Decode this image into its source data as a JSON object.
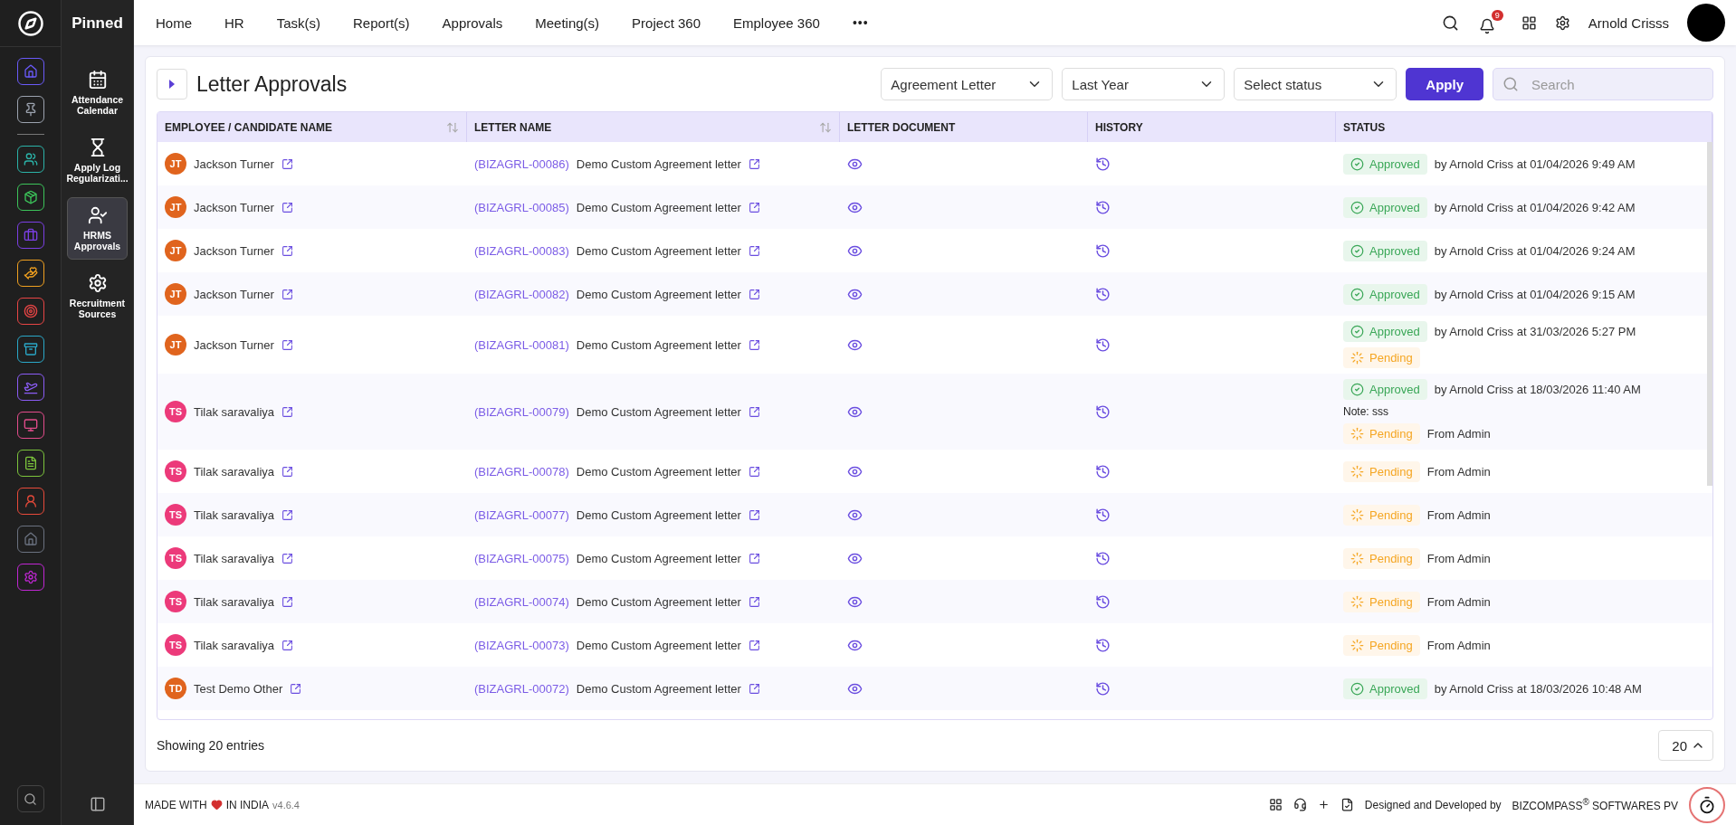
{
  "rail": {
    "items": [
      {
        "color": "#6a5af9",
        "selected": false
      },
      {
        "color": "#9ca3af",
        "selected": false
      },
      {
        "color": "#2bb3a8",
        "selected": false
      },
      {
        "color": "#3cc45a",
        "selected": false
      },
      {
        "color": "#7b3fe4",
        "selected": false
      },
      {
        "color": "#f0a020",
        "selected": false
      },
      {
        "color": "#e84545",
        "selected": false
      },
      {
        "color": "#2aa8c8",
        "selected": false
      },
      {
        "color": "#8b5cf6",
        "selected": false
      },
      {
        "color": "#e44c8c",
        "selected": false
      },
      {
        "color": "#7cc43c",
        "selected": false
      },
      {
        "color": "#e84a3a",
        "selected": false
      },
      {
        "color": "#6b7280",
        "selected": false
      },
      {
        "color": "#c026d3",
        "selected": false
      }
    ]
  },
  "pinned": {
    "title": "Pinned",
    "items": [
      {
        "label": "Attendance Calendar",
        "selected": false
      },
      {
        "label": "Apply Log Regularizati...",
        "selected": false
      },
      {
        "label": "HRMS Approvals",
        "selected": true
      },
      {
        "label": "Recruitment Sources",
        "selected": false
      }
    ]
  },
  "nav": {
    "items": [
      {
        "label": "Home"
      },
      {
        "label": "HR"
      },
      {
        "label": "Task(s)"
      },
      {
        "label": "Report(s)"
      },
      {
        "label": "Approvals"
      },
      {
        "label": "Meeting(s)"
      },
      {
        "label": "Project 360"
      },
      {
        "label": "Employee 360"
      }
    ],
    "more": "•••"
  },
  "header_user": {
    "notifications": "9",
    "name": "Arnold Crisss"
  },
  "page": {
    "title": "Letter Approvals",
    "filters": [
      {
        "value": "Agreement Letter"
      },
      {
        "value": "Last Year"
      },
      {
        "placeholder": "Select status"
      }
    ],
    "apply": "Apply",
    "search": {
      "placeholder": "Search"
    }
  },
  "table": {
    "columns": [
      {
        "label": "EMPLOYEE / CANDIDATE NAME",
        "sortable": true
      },
      {
        "label": "LETTER NAME",
        "sortable": true
      },
      {
        "label": "LETTER DOCUMENT",
        "sortable": false
      },
      {
        "label": "HISTORY",
        "sortable": false
      },
      {
        "label": "STATUS",
        "sortable": false
      }
    ],
    "rows": [
      {
        "initials": "JT",
        "color": "#e0641e",
        "name": "Jackson Turner",
        "code": "(BIZAGRL-00086)",
        "letter": "Demo Custom Agreement letter",
        "statuses": [
          {
            "kind": "approved",
            "label": "Approved",
            "detail": "by Arnold Criss at 01/04/2026 9:49 AM"
          }
        ]
      },
      {
        "initials": "JT",
        "color": "#e0641e",
        "name": "Jackson Turner",
        "code": "(BIZAGRL-00085)",
        "letter": "Demo Custom Agreement letter",
        "statuses": [
          {
            "kind": "approved",
            "label": "Approved",
            "detail": "by Arnold Criss at 01/04/2026 9:42 AM"
          }
        ]
      },
      {
        "initials": "JT",
        "color": "#e0641e",
        "name": "Jackson Turner",
        "code": "(BIZAGRL-00083)",
        "letter": "Demo Custom Agreement letter",
        "statuses": [
          {
            "kind": "approved",
            "label": "Approved",
            "detail": "by Arnold Criss at 01/04/2026 9:24 AM"
          }
        ]
      },
      {
        "initials": "JT",
        "color": "#e0641e",
        "name": "Jackson Turner",
        "code": "(BIZAGRL-00082)",
        "letter": "Demo Custom Agreement letter",
        "statuses": [
          {
            "kind": "approved",
            "label": "Approved",
            "detail": "by Arnold Criss at 01/04/2026 9:15 AM"
          }
        ]
      },
      {
        "initials": "JT",
        "color": "#e0641e",
        "name": "Jackson Turner",
        "code": "(BIZAGRL-00081)",
        "letter": "Demo Custom Agreement letter",
        "statuses": [
          {
            "kind": "approved",
            "label": "Approved",
            "detail": "by Arnold Criss at 31/03/2026 5:27 PM"
          },
          {
            "kind": "pending",
            "label": "Pending"
          }
        ]
      },
      {
        "initials": "TS",
        "color": "#ec3a7a",
        "name": "Tilak saravaliya",
        "code": "(BIZAGRL-00079)",
        "letter": "Demo Custom Agreement letter",
        "statuses": [
          {
            "kind": "approved",
            "label": "Approved",
            "detail": "by Arnold Criss at 18/03/2026 11:40 AM"
          },
          {
            "kind": "note",
            "label": "Note: sss"
          },
          {
            "kind": "pending",
            "label": "Pending",
            "detail": "From Admin"
          }
        ]
      },
      {
        "initials": "TS",
        "color": "#ec3a7a",
        "name": "Tilak saravaliya",
        "code": "(BIZAGRL-00078)",
        "letter": "Demo Custom Agreement letter",
        "statuses": [
          {
            "kind": "pending",
            "label": "Pending",
            "detail": "From Admin"
          }
        ]
      },
      {
        "initials": "TS",
        "color": "#ec3a7a",
        "name": "Tilak saravaliya",
        "code": "(BIZAGRL-00077)",
        "letter": "Demo Custom Agreement letter",
        "statuses": [
          {
            "kind": "pending",
            "label": "Pending",
            "detail": "From Admin"
          }
        ]
      },
      {
        "initials": "TS",
        "color": "#ec3a7a",
        "name": "Tilak saravaliya",
        "code": "(BIZAGRL-00075)",
        "letter": "Demo Custom Agreement letter",
        "statuses": [
          {
            "kind": "pending",
            "label": "Pending",
            "detail": "From Admin"
          }
        ]
      },
      {
        "initials": "TS",
        "color": "#ec3a7a",
        "name": "Tilak saravaliya",
        "code": "(BIZAGRL-00074)",
        "letter": "Demo Custom Agreement letter",
        "statuses": [
          {
            "kind": "pending",
            "label": "Pending",
            "detail": "From Admin"
          }
        ]
      },
      {
        "initials": "TS",
        "color": "#ec3a7a",
        "name": "Tilak saravaliya",
        "code": "(BIZAGRL-00073)",
        "letter": "Demo Custom Agreement letter",
        "statuses": [
          {
            "kind": "pending",
            "label": "Pending",
            "detail": "From Admin"
          }
        ]
      },
      {
        "initials": "TD",
        "color": "#e0641e",
        "name": "Test Demo Other",
        "code": "(BIZAGRL-00072)",
        "letter": "Demo Custom Agreement letter",
        "statuses": [
          {
            "kind": "approved",
            "label": "Approved",
            "detail": "by Arnold Criss at 18/03/2026 10:48 AM"
          }
        ]
      }
    ]
  },
  "table_footer": {
    "summary": "Showing 20 entries",
    "page_size": "20"
  },
  "footer": {
    "made_with": "MADE WITH",
    "in_india": "IN INDIA",
    "version": "v4.6.4",
    "designed_by": "Designed and Developed by",
    "company": "BIZCOMPASS$^{®}$ SOFTWARES PV"
  }
}
